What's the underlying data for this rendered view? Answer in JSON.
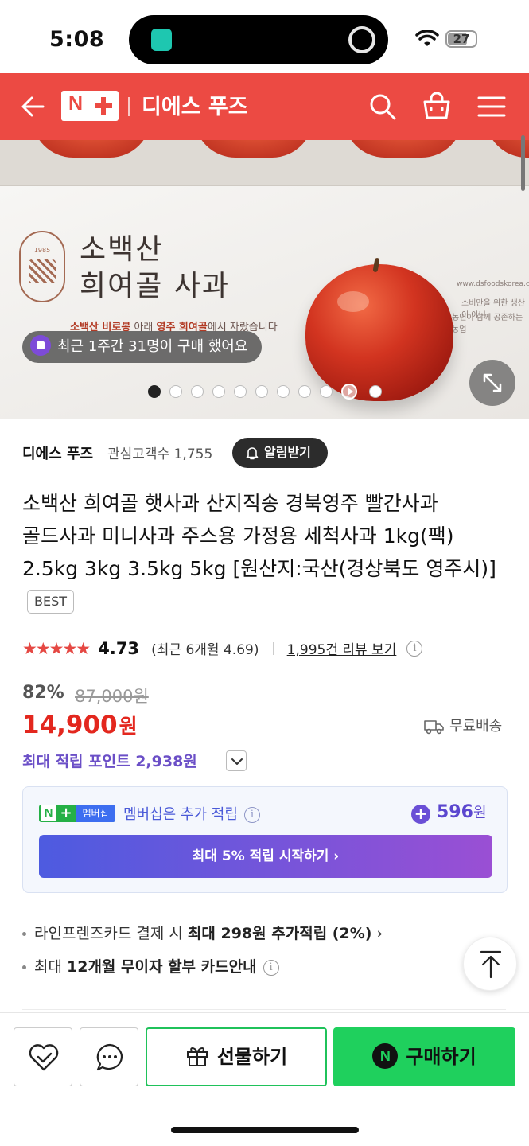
{
  "status_bar": {
    "time": "5:08",
    "battery": "27"
  },
  "header": {
    "logo_letter": "N",
    "store_name": "디에스 푸즈",
    "icons": [
      "back-arrow-icon",
      "search-icon",
      "shopping-bag-icon",
      "menu-icon"
    ],
    "color": "#ec4a43"
  },
  "hero": {
    "box_title_line1": "소백산",
    "box_title_line2": "희여골 사과",
    "box_tagline_pre": "소백산 비로봉",
    "box_tagline_mid": " 아래 ",
    "box_tagline_bold": "영주 희여골",
    "box_tagline_post": "에서 자랐습니다",
    "box_site": "www.dsfoodskorea.com",
    "box_note1": "소비만을 위한 생산이 아닌",
    "box_note2": "농민이 함께 공존하는 농업",
    "seal_year": "1985",
    "recent_buyers": "최근 1주간 31명이 구매 했어요",
    "carousel_count": 11,
    "carousel_active": 0
  },
  "seller": {
    "name": "디에스 푸즈",
    "followers_label": "관심고객수 1,755",
    "alarm_button": "알림받기"
  },
  "product": {
    "title": "소백산 희여골 햇사과 산지직송 경북영주 빨간사과 골드사과 미니사과 주스용 가정용 세척사과 1kg(팩) 2.5kg 3kg 3.5kg 5kg [원산지:국산(경상북도 영주시)]",
    "badge": "BEST",
    "rating": "4.73",
    "recent_rating": "(최근 6개월 4.69)",
    "reviews_link": "1,995건 리뷰 보기"
  },
  "price": {
    "discount": "82%",
    "original": "87,000원",
    "sale": "14,900",
    "sale_unit": "원",
    "shipping": "무료배송",
    "points": "최대 적립 포인트 2,938원"
  },
  "membership": {
    "badge_text": "멤버십",
    "message": "멤버십은 추가 적립",
    "extra_amount": "596",
    "extra_unit": "원",
    "cta": "최대 5% 적립 시작하기 ›"
  },
  "card_benefits": {
    "line1_pre": "라인프렌즈카드 결제 시 ",
    "line1_bold": "최대 298원 추가적립 (2%)",
    "line1_post": " ›",
    "line2_pre": "최대 ",
    "line2_bold": "12개월 무이자 할부 카드안내"
  },
  "bottom_bar": {
    "gift": "선물하기",
    "buy": "구매하기",
    "buy_icon_letter": "N",
    "buy_color": "#1fd05d"
  }
}
